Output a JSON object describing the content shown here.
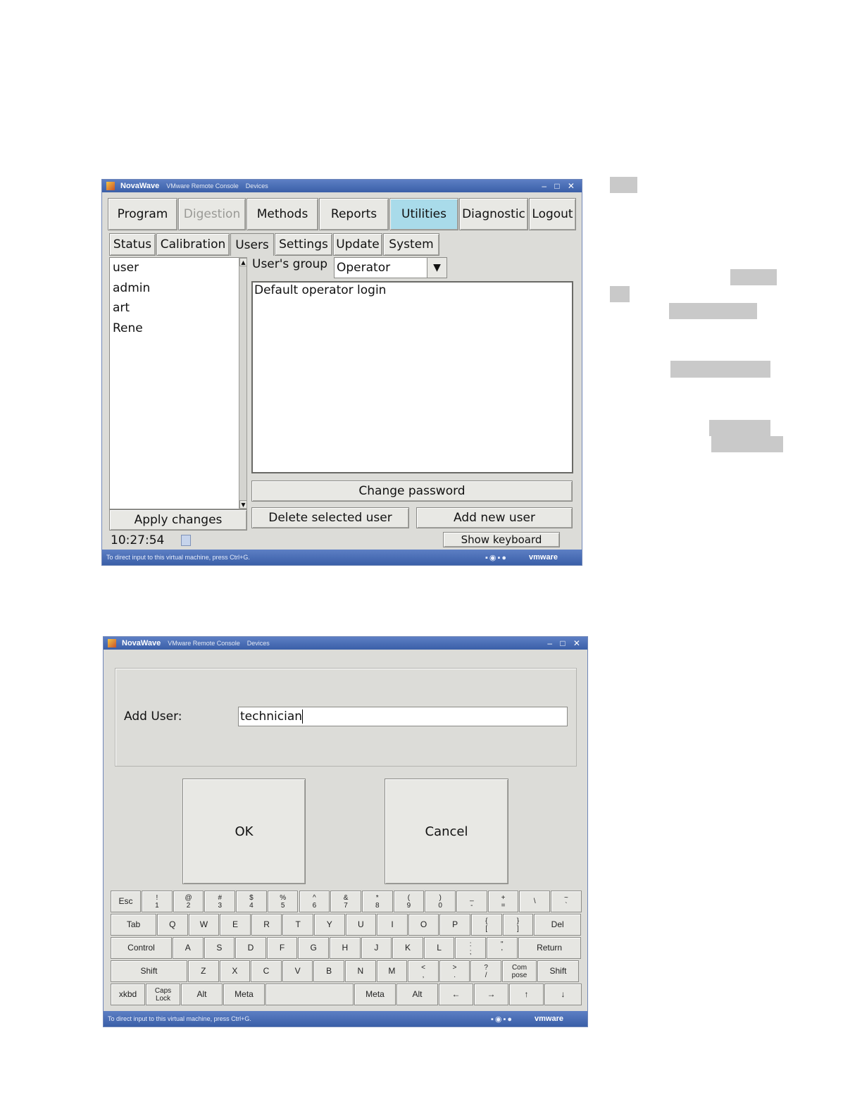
{
  "window1": {
    "titlebar": {
      "app_name": "NovaWave",
      "subtitle": "VMware Remote Console",
      "menu": "Devices"
    },
    "main_tabs": [
      {
        "label": "Program"
      },
      {
        "label": "Digestion",
        "disabled": true
      },
      {
        "label": "Methods"
      },
      {
        "label": "Reports"
      },
      {
        "label": "Utilities",
        "active": true
      },
      {
        "label": "Diagnostic"
      },
      {
        "label": "Logout"
      }
    ],
    "sub_tabs": [
      {
        "label": "Status"
      },
      {
        "label": "Calibration"
      },
      {
        "label": "Users",
        "active": true
      },
      {
        "label": "Settings"
      },
      {
        "label": "Update"
      },
      {
        "label": "System"
      }
    ],
    "users": [
      "user",
      "admin",
      "art",
      "Rene"
    ],
    "group_label": "User's group",
    "group_value": "Operator",
    "description": "Default operator login",
    "buttons": {
      "change_password": "Change password",
      "apply_changes": "Apply changes",
      "delete_user": "Delete selected user",
      "add_user": "Add new user",
      "show_keyboard": "Show keyboard"
    },
    "clock": "10:27:54",
    "statusbar": {
      "hint": "To direct input to this virtual machine, press Ctrl+G.",
      "brand": "vmware"
    }
  },
  "window2": {
    "titlebar": {
      "app_name": "NovaWave",
      "subtitle": "VMware Remote Console",
      "menu": "Devices"
    },
    "add_user_label": "Add User:",
    "add_user_value": "technician",
    "ok_label": "OK",
    "cancel_label": "Cancel",
    "keyboard": {
      "rows": [
        [
          "Esc",
          "!|1",
          "@|2",
          "#|3",
          "$|4",
          "%|5",
          "^|6",
          "&|7",
          "*|8",
          "(|9",
          ")|0",
          "_|-",
          "+|=",
          "||\\",
          "~|`"
        ],
        [
          "Tab",
          "Q",
          "W",
          "E",
          "R",
          "T",
          "Y",
          "U",
          "I",
          "O",
          "P",
          "{|[",
          "}|]",
          "Del"
        ],
        [
          "Control",
          "A",
          "S",
          "D",
          "F",
          "G",
          "H",
          "J",
          "K",
          "L",
          ":|;",
          "\"|'",
          "Return"
        ],
        [
          "Shift",
          "Z",
          "X",
          "C",
          "V",
          "B",
          "N",
          "M",
          "<|,",
          ">|.",
          "?|/",
          "Com|pose",
          "Shift"
        ],
        [
          "xkbd",
          "Caps|Lock",
          "Alt",
          "Meta",
          "",
          "Meta",
          "Alt",
          "←",
          "→",
          "↑",
          "↓"
        ]
      ]
    },
    "statusbar": {
      "hint": "To direct input to this virtual machine, press Ctrl+G.",
      "brand": "vmware"
    }
  }
}
